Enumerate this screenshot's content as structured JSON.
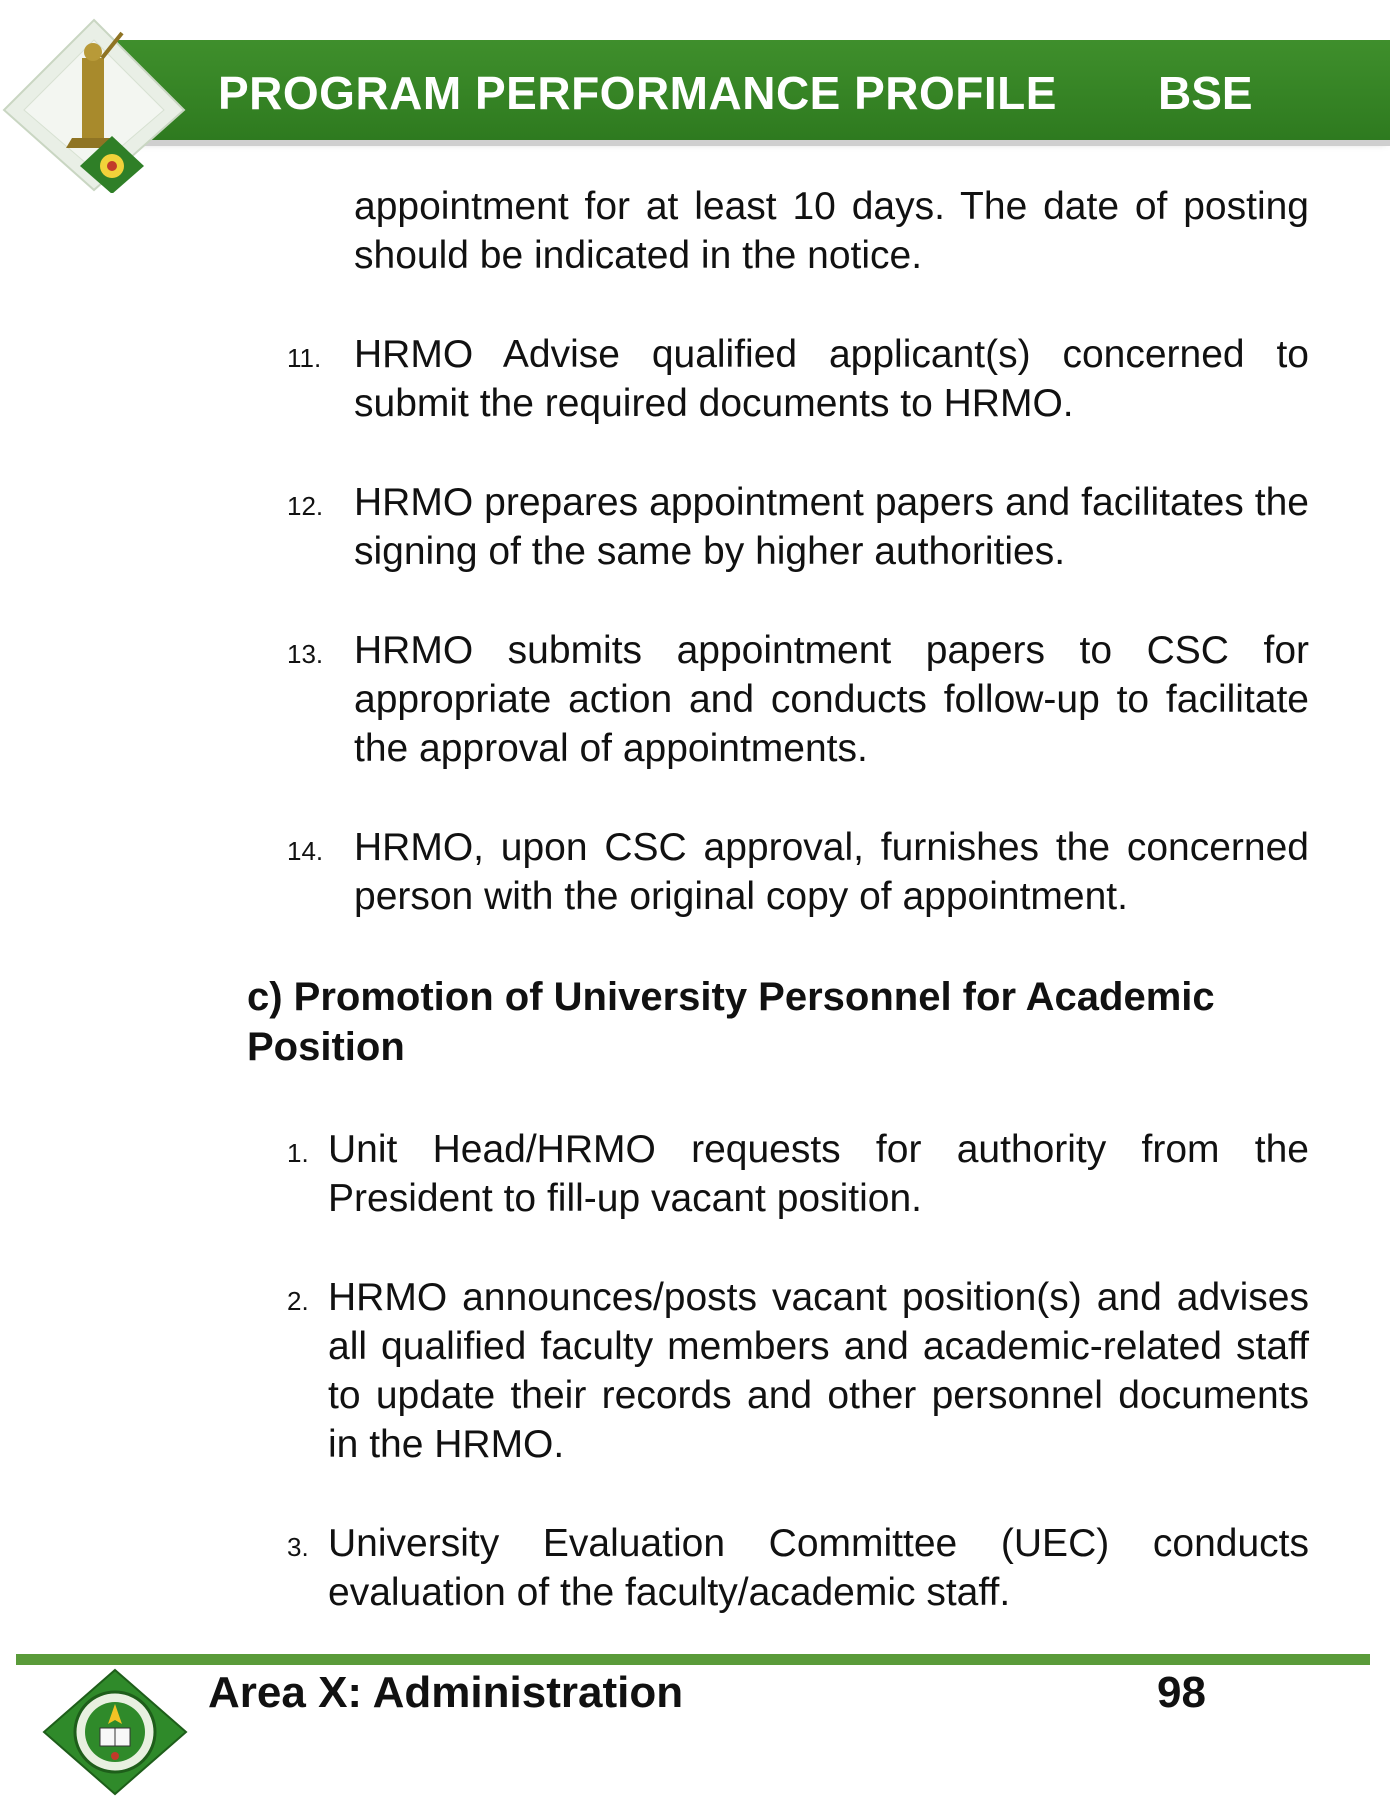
{
  "header": {
    "title": "PROGRAM PERFORMANCE PROFILE",
    "program": "BSE"
  },
  "continuation": "appointment for at least 10 days.  The date of posting should be indicated in the notice.",
  "list_a": [
    {
      "num": "11.",
      "text": "HRMO Advise qualified applicant(s) concerned to submit the required documents to HRMO."
    },
    {
      "num": "12.",
      "text": "HRMO prepares appointment papers and facilitates the signing of the same by higher authorities."
    },
    {
      "num": "13.",
      "text": "HRMO submits appointment papers to CSC for appropriate action and conducts follow-up to facilitate the approval of appointments."
    },
    {
      "num": "14.",
      "text": "HRMO, upon CSC approval, furnishes the concerned person with the original copy of appointment."
    }
  ],
  "section": {
    "heading": "c)   Promotion of University Personnel for Academic Position"
  },
  "list_c": [
    {
      "num": "1.",
      "text": "Unit Head/HRMO requests for authority from the President to fill-up vacant position."
    },
    {
      "num": "2.",
      "text": "HRMO announces/posts vacant position(s) and advises all qualified faculty members and academic-related staff to update their records and other personnel documents in the HRMO."
    },
    {
      "num": "3.",
      "text": "University Evaluation Committee (UEC) conducts evaluation of the faculty/academic staff."
    }
  ],
  "footer": {
    "area": "Area X: Administration",
    "page": "98"
  },
  "colors": {
    "header_green": "#2e7a1f",
    "footer_rule": "#5a9b3a"
  },
  "icons": {
    "top_logo": "university-seal-statue-logo",
    "bottom_logo": "university-seal-logo"
  }
}
